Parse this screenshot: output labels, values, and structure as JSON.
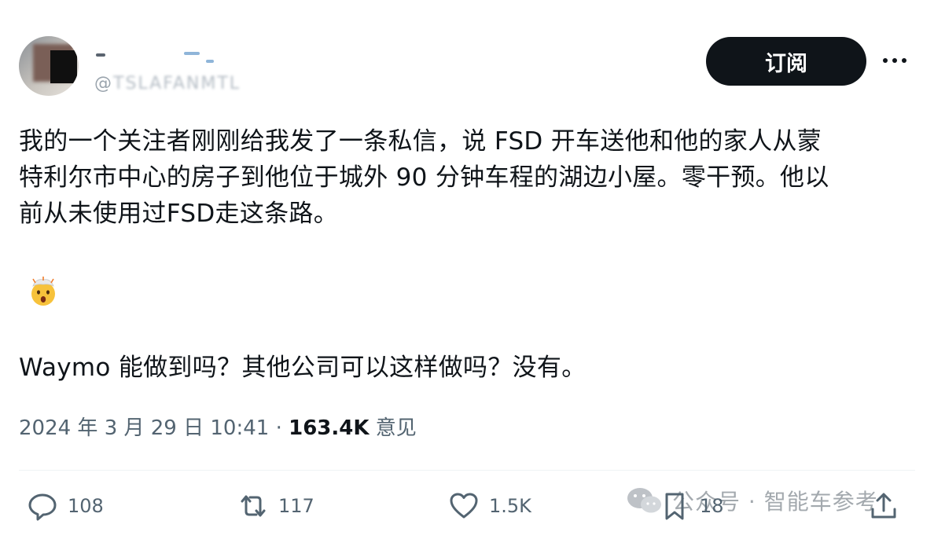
{
  "header": {
    "handle": "@",
    "handle_blurred": "TSLAFANMTL",
    "subscribe_label": "订阅"
  },
  "tweet": {
    "text": "我的一个关注者刚刚给我发了一条私信，说 FSD 开车送他和他的家人从蒙\n特利尔市中心的房子到他位于城外 90 分钟车程的湖边小屋。零干预。他以\n前从未使用过FSD走这条路。",
    "emoji": "exploding-head-emoji",
    "text2": "Waymo 能做到吗？其他公司可以这样做吗？没有。"
  },
  "meta": {
    "timestamp": "2024 年 3 月 29 日 10:41",
    "separator": " · ",
    "views": "163.4K",
    "views_label": " 意见"
  },
  "actions": {
    "reply_count": "108",
    "retweet_count": "117",
    "like_count": "1.5K",
    "bookmark_count": "18"
  },
  "watermark": {
    "text": "公众号 · 智能车参考"
  },
  "colors": {
    "text": "#0f1419",
    "muted": "#536471",
    "button_bg": "#0f1419"
  }
}
